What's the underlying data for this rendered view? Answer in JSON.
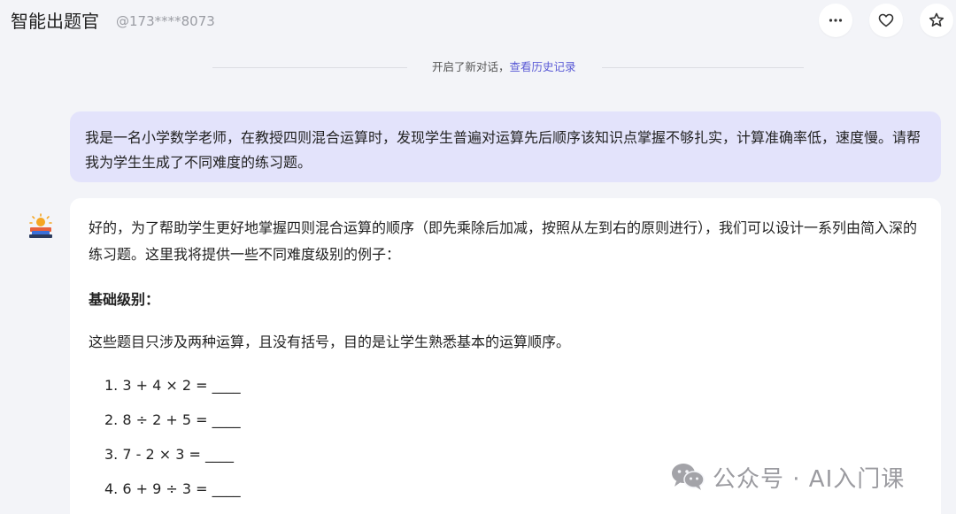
{
  "header": {
    "app_title": "智能出题官",
    "user_id": "@173****8073",
    "more_icon": "more-horizontal-icon",
    "like_icon": "heart-icon",
    "favorite_icon": "star-icon"
  },
  "divider": {
    "text": "开启了新对话，",
    "link_text": "查看历史记录"
  },
  "user_message": {
    "text": "我是一名小学数学老师，在教授四则混合运算时，发现学生普遍对运算先后顺序该知识点掌握不够扎实，计算准确率低，速度慢。请帮我为学生生成了不同难度的练习题。"
  },
  "assistant": {
    "avatar_icon": "assistant-avatar-icon",
    "intro": "好的，为了帮助学生更好地掌握四则混合运算的顺序（即先乘除后加减，按照从左到右的原则进行），我们可以设计一系列由简入深的练习题。这里我将提供一些不同难度级别的例子：",
    "section_title": "基础级别：",
    "section_desc": "这些题目只涉及两种运算，且没有括号，目的是让学生熟悉基本的运算顺序。",
    "exercises": [
      "1. 3 + 4 × 2 = ____",
      "2. 8 ÷ 2 + 5 = ____",
      "3. 7 - 2 × 3 = ____",
      "4. 6 + 9 ÷ 3 = ____"
    ]
  },
  "watermark": {
    "text": "公众号 · AI入门课",
    "icon": "wechat-icon"
  },
  "colors": {
    "background": "#f3f4f8",
    "user_bubble": "#e3e3fb",
    "link": "#5b5bd6",
    "card": "#ffffff"
  }
}
